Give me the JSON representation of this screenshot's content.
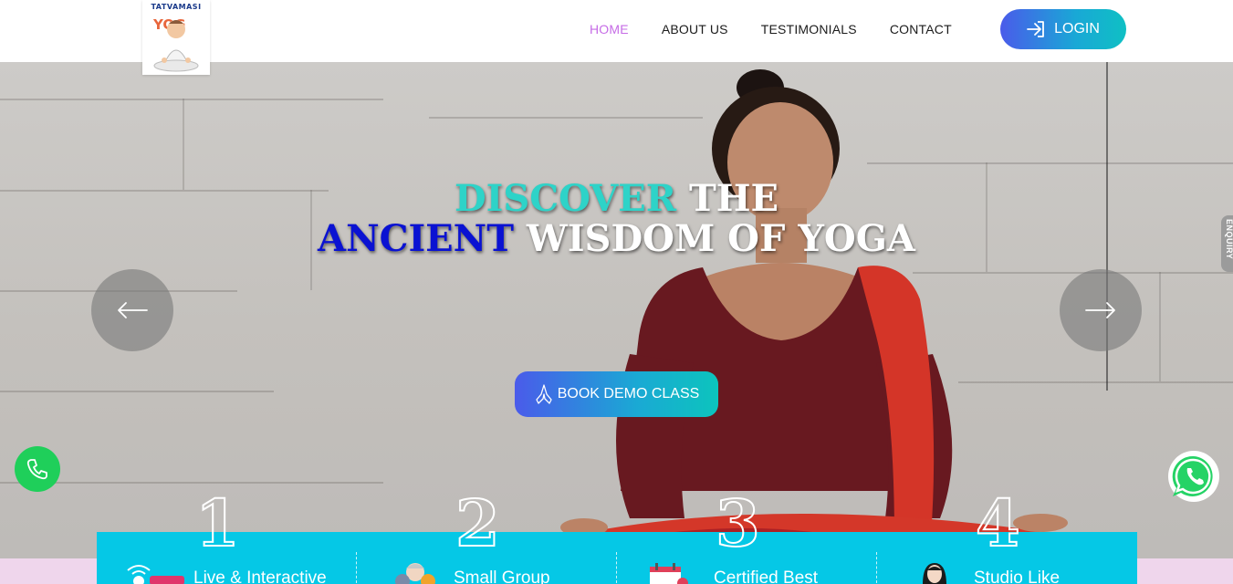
{
  "brand": {
    "name": "TATVAMASI YOG",
    "top_text": "TATVAMASI",
    "logo_word": "YOG"
  },
  "nav": {
    "items": [
      {
        "label": "HOME",
        "active": true
      },
      {
        "label": "ABOUT US",
        "active": false
      },
      {
        "label": "TESTIMONIALS",
        "active": false
      },
      {
        "label": "CONTACT",
        "active": false
      }
    ],
    "active_color": "#c66ce6",
    "login_label": "LOGIN"
  },
  "hero": {
    "line1": {
      "highlight": "DISCOVER",
      "rest": " THE"
    },
    "line2": {
      "highlight": "ANCIENT",
      "rest": " WISDOM OF YOGA"
    },
    "cta_label": "BOOK DEMO CLASS",
    "enquiry_label": "ENQUIRY",
    "prev_icon": "arrow-left-icon",
    "next_icon": "arrow-right-icon"
  },
  "features": [
    {
      "number": "1",
      "label": "Live & Interactive",
      "icon": "live-stream-icon"
    },
    {
      "number": "2",
      "label": "Small Group",
      "icon": "group-icon"
    },
    {
      "number": "3",
      "label": "Certified Best",
      "icon": "calendar-icon"
    },
    {
      "number": "4",
      "label": "Studio Like",
      "icon": "instructor-icon"
    }
  ],
  "colors": {
    "accent_gradient_start": "#4a5bea",
    "accent_gradient_end": "#0fc0c4",
    "headline_teal": "#2ed3c8",
    "headline_blue": "#0a12d2",
    "features_bg": "#05c8e6",
    "phone_green": "#1fcf5a"
  }
}
